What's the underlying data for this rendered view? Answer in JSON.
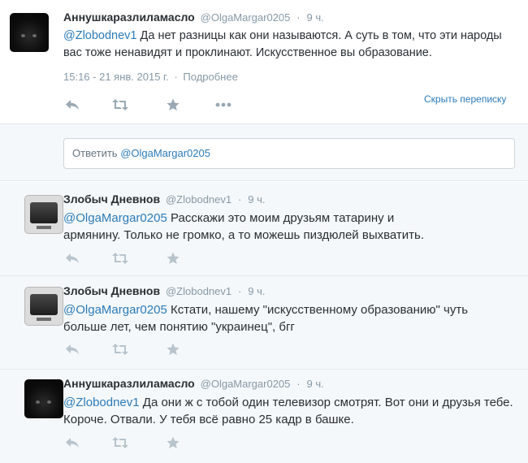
{
  "main_tweet": {
    "name": "Аннушкаразлиламасло",
    "screen_name": "@OlgaMargar0205",
    "separator": "·",
    "time": "9 ч.",
    "mention": "@Zlobodnev1",
    "text": " Да нет разницы как они называются. А суть в том, что эти народы вас тоже ненавидят и проклинают. Искусственное вы образование.",
    "date": "15:16 - 21 янв. 2015 г.",
    "date_sep": "·",
    "details": "Подробнее",
    "hide_conversation": "Скрыть переписку"
  },
  "reply_box": {
    "prefix": "Ответить ",
    "handle": "@OlgaMargar0205"
  },
  "conversation": [
    {
      "name": "Злобыч Дневнов",
      "screen_name": "@Zlobodnev1",
      "separator": "·",
      "time": "9 ч.",
      "mention": "@OlgaMargar0205",
      "text": " Расскажи это моим друзьям татарину и армянину. Только не громко, а то можешь пиздюлей выхватить.",
      "avatar": "tv"
    },
    {
      "name": "Злобыч Дневнов",
      "screen_name": "@Zlobodnev1",
      "separator": "·",
      "time": "9 ч.",
      "mention": "@OlgaMargar0205",
      "text": " Кстати, нашему \"искусственному образованию\" чуть больше лет, чем понятию \"украинец\", бгг",
      "avatar": "tv"
    },
    {
      "name": "Аннушкаразлиламасло",
      "screen_name": "@OlgaMargar0205",
      "separator": "·",
      "time": "9 ч.",
      "mention": "@Zlobodnev1",
      "text": " Да они ж с тобой один телевизор смотрят. Вот они и друзья тебе. Короче. Отвали. У тебя всё равно 25 кадр в башке.",
      "avatar": "cat"
    }
  ],
  "icons": {
    "reply": "reply-arrow-icon",
    "retweet": "retweet-icon",
    "favorite": "star-icon",
    "more": "more-dots-icon"
  },
  "colors": {
    "link": "#2b7bb9",
    "muted": "#8899a6",
    "action": "#99a8b3",
    "conversation_bg": "#f5f8fa"
  }
}
